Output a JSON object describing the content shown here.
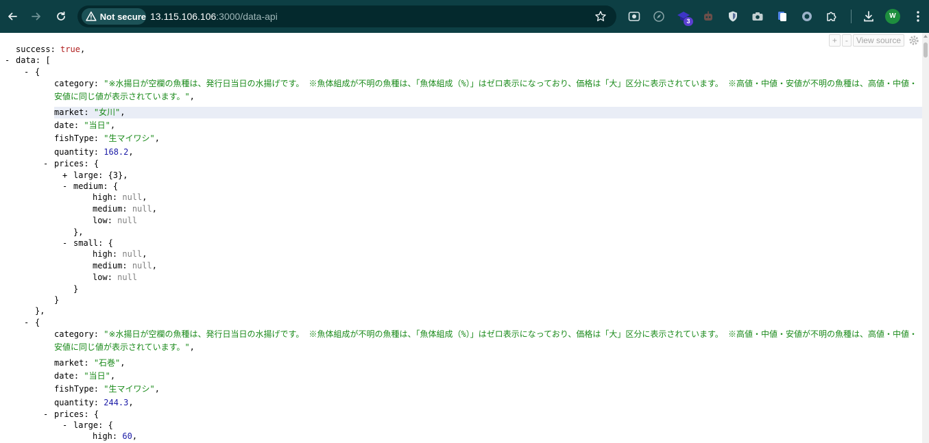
{
  "browser": {
    "security_label": "Not secure",
    "url_host": "13.115.106.106",
    "url_path": ":3000/data-api",
    "extension_badge": "3",
    "avatar_initial": "W",
    "accent": "#0d3f44"
  },
  "viewer": {
    "expand_label": "+",
    "collapse_label": "-",
    "view_source_label": "View source"
  },
  "json": {
    "lines": [
      {
        "tog": "",
        "key": "success",
        "val": "true",
        "vt": "b",
        "tail": ",",
        "hl": false
      },
      {
        "tog": "-",
        "key": "data",
        "val": "[",
        "vt": "p",
        "tail": "",
        "hl": false
      },
      {
        "tog": "-",
        "key": "",
        "val": "{",
        "vt": "p",
        "tail": "",
        "hl": false
      },
      {
        "tog": "",
        "key": "category",
        "val": "\"※水揚日が空欄の魚種は、発行日当日の水揚げです。 ※魚体組成が不明の魚種は、「魚体組成（%）」はゼロ表示になっており、価格は「大」区分に表示されています。 ※高値・中値・安値が不明の魚種は、高値・中値・安値に同じ値が表示されています。\"",
        "vt": "s",
        "tail": ",",
        "hl": false,
        "wrap": true
      },
      {
        "tog": "",
        "key": "market",
        "val": "\"女川\"",
        "vt": "s",
        "tail": ",",
        "hl": true
      },
      {
        "tog": "",
        "key": "date",
        "val": "\"当日\"",
        "vt": "s",
        "tail": ",",
        "hl": false
      },
      {
        "tog": "",
        "key": "fishType",
        "val": "\"生マイワシ\"",
        "vt": "s",
        "tail": ",",
        "hl": false
      },
      {
        "tog": "",
        "key": "quantity",
        "val": "168.2",
        "vt": "n",
        "tail": ",",
        "hl": false
      },
      {
        "tog": "-",
        "key": "prices",
        "val": "{",
        "vt": "p",
        "tail": "",
        "hl": false
      },
      {
        "tog": "+",
        "key": "large",
        "val": "{3}",
        "vt": "p",
        "tail": ",",
        "hl": false
      },
      {
        "tog": "-",
        "key": "medium",
        "val": "{",
        "vt": "p",
        "tail": "",
        "hl": false
      },
      {
        "tog": "",
        "key": "high",
        "val": "null",
        "vt": "nl",
        "tail": ",",
        "hl": false
      },
      {
        "tog": "",
        "key": "medium",
        "val": "null",
        "vt": "nl",
        "tail": ",",
        "hl": false
      },
      {
        "tog": "",
        "key": "low",
        "val": "null",
        "vt": "nl",
        "tail": "",
        "hl": false
      },
      {
        "tog": "",
        "key": "",
        "val": "}",
        "vt": "p",
        "tail": ",",
        "hl": false
      },
      {
        "tog": "-",
        "key": "small",
        "val": "{",
        "vt": "p",
        "tail": "",
        "hl": false
      },
      {
        "tog": "",
        "key": "high",
        "val": "null",
        "vt": "nl",
        "tail": ",",
        "hl": false
      },
      {
        "tog": "",
        "key": "medium",
        "val": "null",
        "vt": "nl",
        "tail": ",",
        "hl": false
      },
      {
        "tog": "",
        "key": "low",
        "val": "null",
        "vt": "nl",
        "tail": "",
        "hl": false
      },
      {
        "tog": "",
        "key": "",
        "val": "}",
        "vt": "p",
        "tail": "",
        "hl": false
      },
      {
        "tog": "",
        "key": "",
        "val": "}",
        "vt": "p",
        "tail": "",
        "hl": false
      },
      {
        "tog": "",
        "key": "",
        "val": "}",
        "vt": "p",
        "tail": ",",
        "hl": false
      },
      {
        "tog": "-",
        "key": "",
        "val": "{",
        "vt": "p",
        "tail": "",
        "hl": false
      },
      {
        "tog": "",
        "key": "category",
        "val": "\"※水揚日が空欄の魚種は、発行日当日の水揚げです。 ※魚体組成が不明の魚種は、「魚体組成（%）」はゼロ表示になっており、価格は「大」区分に表示されています。 ※高値・中値・安値が不明の魚種は、高値・中値・安値に同じ値が表示されています。\"",
        "vt": "s",
        "tail": ",",
        "hl": false,
        "wrap": true
      },
      {
        "tog": "",
        "key": "market",
        "val": "\"石巻\"",
        "vt": "s",
        "tail": ",",
        "hl": false
      },
      {
        "tog": "",
        "key": "date",
        "val": "\"当日\"",
        "vt": "s",
        "tail": ",",
        "hl": false
      },
      {
        "tog": "",
        "key": "fishType",
        "val": "\"生マイワシ\"",
        "vt": "s",
        "tail": ",",
        "hl": false
      },
      {
        "tog": "",
        "key": "quantity",
        "val": "244.3",
        "vt": "n",
        "tail": ",",
        "hl": false
      },
      {
        "tog": "-",
        "key": "prices",
        "val": "{",
        "vt": "p",
        "tail": "",
        "hl": false
      },
      {
        "tog": "-",
        "key": "large",
        "val": "{",
        "vt": "p",
        "tail": "",
        "hl": false
      },
      {
        "tog": "",
        "key": "high",
        "val": "60",
        "vt": "n",
        "tail": ",",
        "hl": false
      }
    ]
  }
}
